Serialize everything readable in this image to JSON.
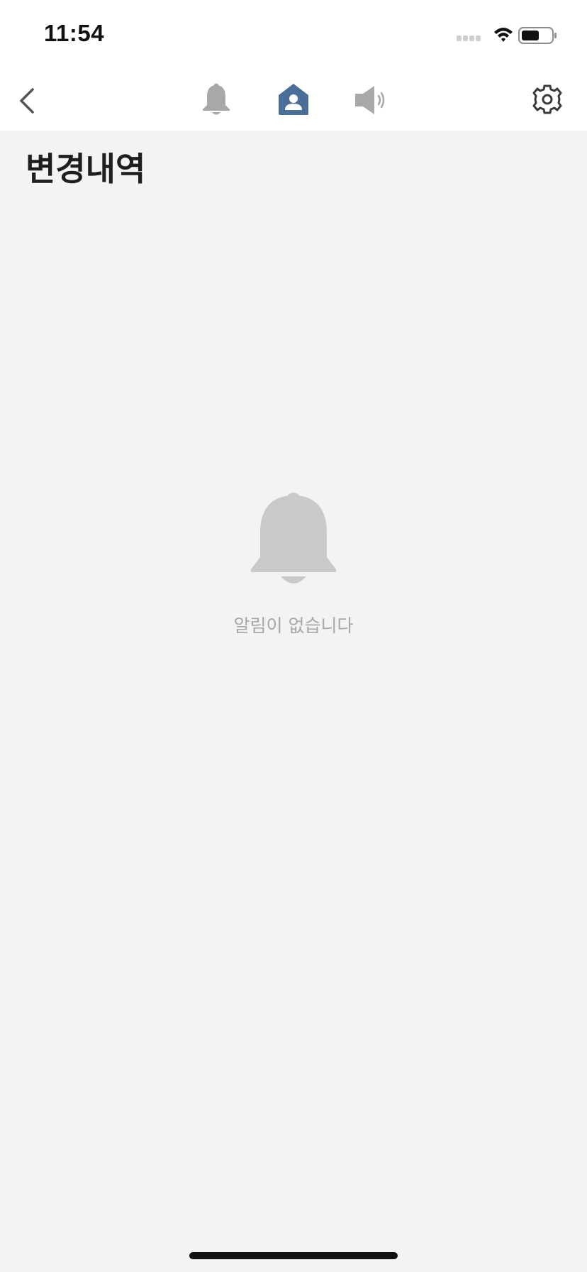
{
  "status_bar": {
    "time": "11:54",
    "icons": [
      "signal-icon",
      "wifi-icon",
      "battery-icon"
    ],
    "battery_level": 0.6
  },
  "nav": {
    "back_icon": "chevron-left-icon",
    "tabs": [
      {
        "icon": "bell-icon",
        "active": false
      },
      {
        "icon": "user-tag-icon",
        "active": true
      },
      {
        "icon": "speaker-icon",
        "active": false
      }
    ],
    "settings_icon": "gear-icon",
    "active_color": "#4a6f96",
    "inactive_color": "#a8a8aa"
  },
  "page": {
    "title": "변경내역"
  },
  "empty_state": {
    "icon": "bell-icon",
    "message": "알림이 없습니다",
    "icon_color": "#c9c9cb"
  }
}
